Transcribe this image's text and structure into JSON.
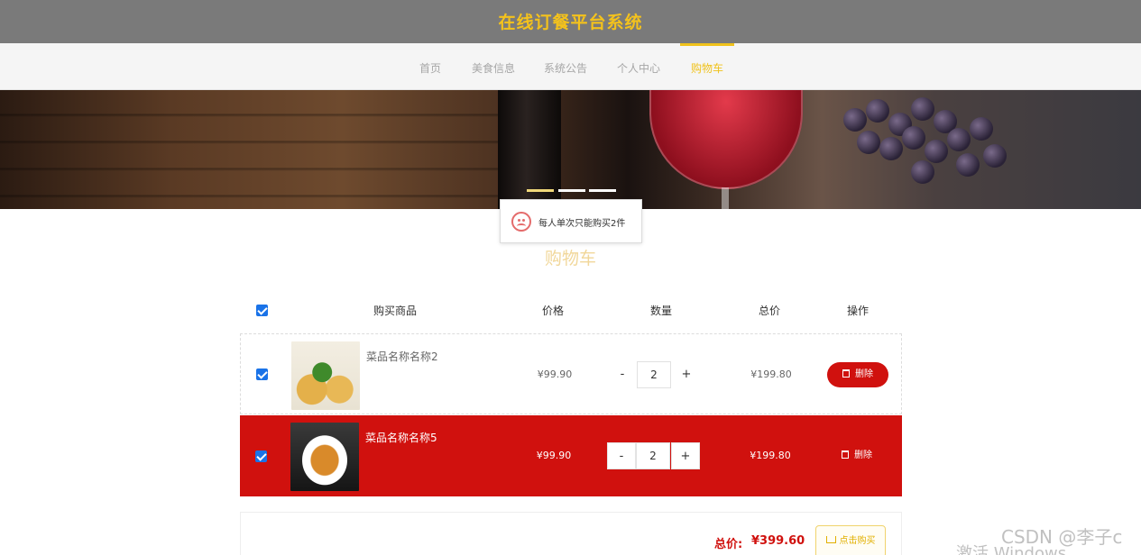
{
  "header": {
    "title": "在线订餐平台系统"
  },
  "nav": {
    "items": [
      {
        "label": "首页"
      },
      {
        "label": "美食信息"
      },
      {
        "label": "系统公告"
      },
      {
        "label": "个人中心"
      },
      {
        "label": "购物车"
      }
    ],
    "active": "购物车"
  },
  "banner": {
    "slides": 3,
    "active_slide": 1
  },
  "toast": {
    "message": "每人单次只能购买2件",
    "icon": "sad-face-icon"
  },
  "cart": {
    "title": "购物车",
    "headers": {
      "product": "购买商品",
      "price": "价格",
      "quantity": "数量",
      "total": "总价",
      "action": "操作"
    },
    "select_all_checked": true,
    "items": [
      {
        "name": "菜品名称名称2",
        "price": "¥99.90",
        "qty": "2",
        "total": "¥199.80",
        "delete_label": "删除",
        "checked": true,
        "minus": "-",
        "plus": "+"
      },
      {
        "name": "菜品名称名称5",
        "price": "¥99.90",
        "qty": "2",
        "total": "¥199.80",
        "delete_label": "删除",
        "checked": true,
        "minus": "-",
        "plus": "+"
      }
    ],
    "summary": {
      "total_label": "总价:",
      "total_value": "¥399.60",
      "buy_label": "点击购买"
    }
  },
  "colors": {
    "accent": "#f0c21c",
    "danger": "#d0110e",
    "header_bg": "#7a7a7a"
  },
  "watermark": {
    "csdn": "CSDN @李子c",
    "windows": "激活 Windows"
  }
}
